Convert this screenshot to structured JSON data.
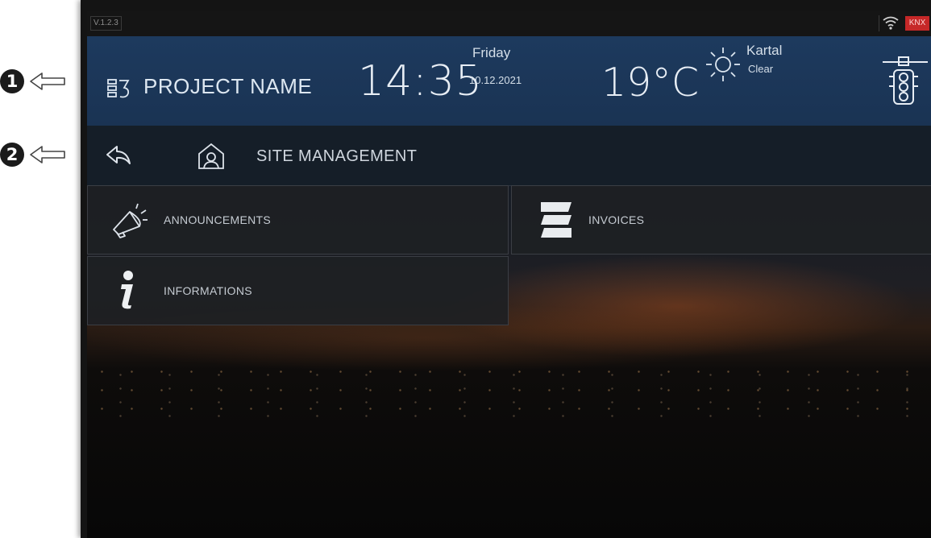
{
  "annotations": [
    {
      "number": "1",
      "icon": "left-arrow-outline-icon"
    },
    {
      "number": "2",
      "icon": "left-arrow-outline-icon"
    }
  ],
  "status_bar": {
    "version": "V.1.2.3",
    "wifi_icon": "wifi-icon",
    "knx_label": "KNX",
    "knx_color": "#c62828"
  },
  "header": {
    "project_icon": "building-floors-icon",
    "project_name": "PROJECT NAME",
    "time": "14:35",
    "day": "Friday",
    "date": "10.12.2021",
    "temperature": "19°C",
    "weather_icon": "sun-icon",
    "location": "Kartal",
    "condition": "Clear",
    "right_icon": "traffic-light-icon",
    "background_color": "#1d3a5e"
  },
  "nav": {
    "back_icon": "back-arrow-icon",
    "section_icon": "house-person-icon",
    "title": "SITE MANAGEMENT"
  },
  "menu": {
    "items": [
      {
        "label": "ANNOUNCEMENTS",
        "icon": "megaphone-icon"
      },
      {
        "label": "INVOICES",
        "icon": "stack-icon"
      },
      {
        "label": "INFORMATIONS",
        "icon": "info-icon"
      }
    ]
  }
}
